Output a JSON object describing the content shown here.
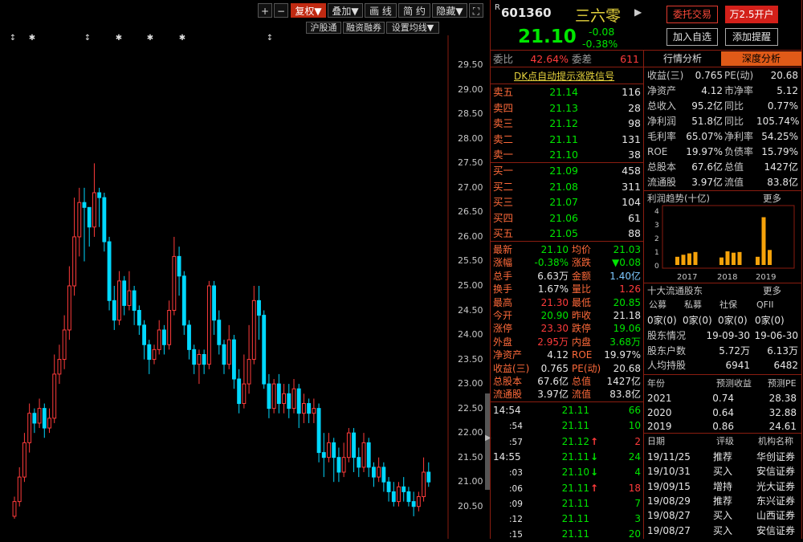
{
  "toolbar": {
    "zoom_in": "+",
    "zoom_out": "−",
    "fuquan": "复权▼",
    "diejia": "叠加▼",
    "huaxian": "画 线",
    "jianyue": "简 约",
    "yincang": "隐藏▼",
    "fullscreen": "⛶",
    "hugutong": "沪股通",
    "rongzi": "融资融券",
    "shezhi": "设置均线▼"
  },
  "chart_data": {
    "type": "candlestick",
    "y_ticks": [
      "29.50",
      "29.00",
      "28.50",
      "28.00",
      "27.50",
      "27.00",
      "26.50",
      "26.00",
      "25.50",
      "25.00",
      "24.50",
      "24.00",
      "23.50",
      "23.00",
      "22.50",
      "22.00",
      "21.50",
      "21.00",
      "20.50"
    ],
    "ylim": [
      20.25,
      29.75
    ],
    "candles": [
      [
        20.3,
        20.6,
        20.25,
        20.7
      ],
      [
        20.6,
        21.1,
        20.5,
        21.3
      ],
      [
        21.1,
        21.8,
        21.0,
        22.0
      ],
      [
        21.8,
        22.4,
        21.6,
        22.6
      ],
      [
        22.4,
        22.2,
        22.0,
        22.5
      ],
      [
        22.2,
        22.5,
        22.1,
        22.7
      ],
      [
        22.5,
        22.1,
        21.9,
        22.6
      ],
      [
        22.1,
        22.3,
        22.0,
        22.5
      ],
      [
        22.3,
        23.2,
        22.2,
        23.6
      ],
      [
        23.2,
        23.5,
        23.0,
        23.8
      ],
      [
        23.5,
        24.1,
        23.3,
        24.4
      ],
      [
        24.1,
        25.0,
        23.9,
        25.4
      ],
      [
        25.0,
        26.0,
        24.8,
        26.8
      ],
      [
        26.0,
        26.7,
        25.6,
        27.0
      ],
      [
        26.7,
        26.6,
        25.5,
        27.0
      ],
      [
        26.6,
        26.2,
        25.8,
        26.6
      ],
      [
        26.2,
        26.9,
        26.0,
        27.5
      ],
      [
        26.9,
        26.8,
        26.2,
        27.0
      ],
      [
        26.8,
        25.9,
        25.7,
        26.9
      ],
      [
        25.9,
        24.7,
        24.5,
        26.0
      ],
      [
        24.7,
        24.3,
        24.1,
        25.0
      ],
      [
        24.3,
        25.1,
        24.2,
        25.3
      ],
      [
        25.1,
        24.6,
        24.4,
        25.2
      ],
      [
        24.6,
        24.9,
        24.5,
        25.3
      ],
      [
        24.9,
        24.5,
        24.2,
        25.0
      ],
      [
        24.5,
        24.2,
        24.0,
        24.6
      ],
      [
        24.2,
        23.8,
        23.5,
        24.3
      ],
      [
        23.8,
        23.5,
        23.2,
        23.9
      ],
      [
        23.5,
        23.7,
        23.4,
        23.8
      ],
      [
        23.7,
        24.1,
        23.6,
        24.3
      ],
      [
        24.1,
        23.8,
        23.6,
        24.2
      ],
      [
        23.8,
        24.5,
        23.7,
        24.7
      ],
      [
        24.5,
        25.6,
        24.4,
        26.0
      ],
      [
        25.6,
        25.2,
        24.8,
        25.8
      ],
      [
        25.2,
        24.2,
        24.0,
        25.3
      ],
      [
        24.2,
        23.7,
        23.5,
        24.3
      ],
      [
        23.7,
        23.4,
        23.2,
        23.8
      ],
      [
        23.4,
        23.6,
        23.0,
        23.7
      ],
      [
        23.6,
        23.4,
        23.2,
        23.7
      ],
      [
        23.4,
        25.0,
        23.3,
        25.1
      ],
      [
        25.0,
        24.3,
        24.0,
        25.1
      ],
      [
        24.3,
        23.8,
        23.6,
        24.5
      ],
      [
        23.8,
        23.4,
        23.2,
        23.9
      ],
      [
        23.4,
        23.9,
        23.3,
        24.2
      ],
      [
        23.9,
        23.1,
        22.9,
        24.0
      ],
      [
        23.1,
        22.6,
        22.4,
        23.3
      ],
      [
        22.6,
        23.0,
        22.5,
        23.6
      ],
      [
        23.0,
        23.5,
        22.8,
        24.2
      ],
      [
        23.5,
        24.7,
        23.4,
        25.0
      ],
      [
        24.7,
        24.4,
        23.9,
        25.0
      ],
      [
        24.4,
        23.0,
        22.9,
        24.5
      ],
      [
        23.0,
        22.5,
        22.3,
        23.2
      ],
      [
        22.5,
        23.0,
        22.4,
        23.1
      ],
      [
        23.0,
        22.6,
        22.4,
        23.2
      ],
      [
        22.6,
        22.8,
        22.4,
        23.0
      ],
      [
        22.8,
        22.5,
        22.3,
        23.0
      ],
      [
        22.5,
        22.9,
        22.4,
        23.1
      ],
      [
        22.9,
        22.4,
        22.1,
        23.0
      ],
      [
        22.4,
        22.6,
        22.2,
        22.8
      ],
      [
        22.6,
        22.4,
        22.2,
        22.7
      ],
      [
        22.4,
        22.5,
        22.2,
        22.7
      ],
      [
        22.5,
        21.6,
        21.4,
        22.6
      ],
      [
        21.6,
        21.5,
        21.1,
        22.0
      ],
      [
        21.5,
        21.8,
        21.4,
        22.0
      ],
      [
        21.8,
        21.5,
        21.0,
        21.9
      ],
      [
        21.5,
        21.2,
        21.0,
        21.7
      ],
      [
        21.2,
        21.5,
        21.1,
        21.8
      ],
      [
        21.5,
        22.0,
        21.4,
        22.1
      ],
      [
        22.0,
        21.5,
        21.2,
        22.1
      ],
      [
        21.5,
        21.3,
        21.1,
        21.7
      ],
      [
        21.3,
        21.8,
        21.2,
        22.0
      ],
      [
        21.8,
        21.3,
        21.1,
        21.9
      ],
      [
        21.3,
        21.1,
        20.9,
        21.4
      ],
      [
        21.1,
        21.3,
        21.0,
        21.5
      ],
      [
        21.3,
        21.0,
        20.8,
        21.4
      ],
      [
        21.0,
        20.8,
        20.6,
        21.1
      ],
      [
        20.8,
        20.6,
        20.5,
        21.0
      ],
      [
        20.6,
        20.9,
        20.5,
        21.0
      ],
      [
        20.9,
        20.8,
        20.6,
        21.1
      ],
      [
        20.8,
        20.6,
        20.5,
        20.9
      ],
      [
        20.6,
        20.5,
        20.3,
        20.8
      ],
      [
        20.5,
        20.7,
        20.4,
        20.8
      ],
      [
        20.7,
        21.2,
        20.6,
        21.5
      ],
      [
        21.2,
        21.0,
        20.9,
        21.4
      ]
    ],
    "markers": [
      "↕",
      "✱",
      "↕",
      "✱",
      "✱",
      "✱",
      "↕",
      "↕"
    ]
  },
  "quote": {
    "prefix": "R",
    "code": "601360",
    "name": "三六零",
    "price": "21.10",
    "change": "-0.08",
    "change_pct": "-0.38%",
    "btn_weituo": "委托交易",
    "btn_kaihu": "万2.5开户",
    "btn_zixuan": "加入自选",
    "btn_tixing": "添加提醒"
  },
  "weibi": {
    "label1": "委比",
    "val1": "42.64%",
    "label2": "委差",
    "val2": "611"
  },
  "dk_signal": "DK点自动提示涨跌信号",
  "asks": [
    {
      "label": "卖五",
      "price": "21.14",
      "vol": "116"
    },
    {
      "label": "卖四",
      "price": "21.13",
      "vol": "28"
    },
    {
      "label": "卖三",
      "price": "21.12",
      "vol": "98"
    },
    {
      "label": "卖二",
      "price": "21.11",
      "vol": "131"
    },
    {
      "label": "卖一",
      "price": "21.10",
      "vol": "38"
    }
  ],
  "bids": [
    {
      "label": "买一",
      "price": "21.09",
      "vol": "458"
    },
    {
      "label": "买二",
      "price": "21.08",
      "vol": "311"
    },
    {
      "label": "买三",
      "price": "21.07",
      "vol": "104"
    },
    {
      "label": "买四",
      "price": "21.06",
      "vol": "61"
    },
    {
      "label": "买五",
      "price": "21.05",
      "vol": "88"
    }
  ],
  "stats": [
    {
      "l1": "最新",
      "v1": "21.10",
      "c1": "green",
      "l2": "均价",
      "v2": "21.03",
      "c2": "green"
    },
    {
      "l1": "涨幅",
      "v1": "-0.38%",
      "c1": "green",
      "l2": "涨跌",
      "v2": "▼0.08",
      "c2": "green"
    },
    {
      "l1": "总手",
      "v1": "6.63万",
      "c1": "white",
      "l2": "金额",
      "v2": "1.40亿",
      "c2": "cyan"
    },
    {
      "l1": "换手",
      "v1": "1.67%",
      "c1": "white",
      "l2": "量比",
      "v2": "1.26",
      "c2": "red"
    },
    {
      "l1": "最高",
      "v1": "21.30",
      "c1": "red",
      "l2": "最低",
      "v2": "20.85",
      "c2": "green"
    },
    {
      "l1": "今开",
      "v1": "20.90",
      "c1": "green",
      "l2": "昨收",
      "v2": "21.18",
      "c2": "white"
    },
    {
      "l1": "涨停",
      "v1": "23.30",
      "c1": "red",
      "l2": "跌停",
      "v2": "19.06",
      "c2": "green"
    },
    {
      "l1": "外盘",
      "v1": "2.95万",
      "c1": "red",
      "l2": "内盘",
      "v2": "3.68万",
      "c2": "green"
    },
    {
      "l1": "净资产",
      "v1": "4.12",
      "c1": "white",
      "l2": "ROE",
      "v2": "19.97%",
      "c2": "white"
    },
    {
      "l1": "收益(三)",
      "v1": "0.765",
      "c1": "white",
      "l2": "PE(动)",
      "v2": "20.68",
      "c2": "white"
    },
    {
      "l1": "总股本",
      "v1": "67.6亿",
      "c1": "white",
      "l2": "总值",
      "v2": "1427亿",
      "c2": "white"
    },
    {
      "l1": "流通股",
      "v1": "3.97亿",
      "c1": "white",
      "l2": "流值",
      "v2": "83.8亿",
      "c2": "white"
    }
  ],
  "ticks": [
    {
      "time": "14:54",
      "price": "21.11",
      "arrow": "",
      "vol": "66",
      "vc": "green"
    },
    {
      "time": ":54",
      "price": "21.11",
      "arrow": "",
      "vol": "10",
      "vc": "green"
    },
    {
      "time": ":57",
      "price": "21.12",
      "arrow": "↑",
      "vol": "2",
      "vc": "red"
    },
    {
      "time": "14:55",
      "price": "21.11",
      "arrow": "↓",
      "vol": "24",
      "vc": "green"
    },
    {
      "time": ":03",
      "price": "21.10",
      "arrow": "↓",
      "vol": "4",
      "vc": "green"
    },
    {
      "time": ":06",
      "price": "21.11",
      "arrow": "↑",
      "vol": "18",
      "vc": "red"
    },
    {
      "time": ":09",
      "price": "21.11",
      "arrow": "",
      "vol": "7",
      "vc": "green"
    },
    {
      "time": ":12",
      "price": "21.11",
      "arrow": "",
      "vol": "3",
      "vc": "green"
    },
    {
      "time": ":15",
      "price": "21.11",
      "arrow": "",
      "vol": "20",
      "vc": "green"
    }
  ],
  "tabs": {
    "hangqing": "行情分析",
    "shendu": "深度分析"
  },
  "fundamentals": [
    {
      "l1": "收益(三)",
      "v1": "0.765",
      "l2": "PE(动)",
      "v2": "20.68"
    },
    {
      "l1": "净资产",
      "v1": "4.12",
      "l2": "市净率",
      "v2": "5.12"
    },
    {
      "l1": "总收入",
      "v1": "95.2亿",
      "l2": "同比",
      "v2": "0.77%"
    },
    {
      "l1": "净利润",
      "v1": "51.8亿",
      "l2": "同比",
      "v2": "105.74%"
    },
    {
      "l1": "毛利率",
      "v1": "65.07%",
      "l2": "净利率",
      "v2": "54.25%"
    },
    {
      "l1": "ROE",
      "v1": "19.97%",
      "l2": "负债率",
      "v2": "15.79%"
    },
    {
      "l1": "总股本",
      "v1": "67.6亿",
      "l2": "总值",
      "v2": "1427亿"
    },
    {
      "l1": "流通股",
      "v1": "3.97亿",
      "l2": "流值",
      "v2": "83.8亿"
    }
  ],
  "profit_trend": {
    "title": "利润趋势(十亿)",
    "more": "更多",
    "y_ticks": [
      "4",
      "3",
      "2",
      "1",
      "0"
    ],
    "years": [
      "2017",
      "2018",
      "2019"
    ],
    "bars": [
      0.6,
      0.75,
      0.85,
      0.95,
      0.55,
      1.0,
      0.9,
      0.95,
      0.6,
      3.5,
      1.1
    ],
    "ylim": [
      0,
      4
    ]
  },
  "holders": {
    "title": "十大流通股东",
    "more": "更多",
    "headers": [
      "公募",
      "私募",
      "社保",
      "QFII"
    ],
    "values": [
      "0家(0)",
      "0家(0)",
      "0家(0)",
      "0家(0)"
    ]
  },
  "holder_stats": [
    {
      "l": "股东情况",
      "v1": "19-09-30",
      "v2": "19-06-30"
    },
    {
      "l": "股东户数",
      "v1": "5.72万",
      "v2": "6.13万"
    },
    {
      "l": "人均持股",
      "v1": "6941",
      "v2": "6482"
    }
  ],
  "forecast": {
    "headers": [
      "年份",
      "预测收益",
      "预测PE"
    ],
    "rows": [
      [
        "2021",
        "0.74",
        "28.38"
      ],
      [
        "2020",
        "0.64",
        "32.88"
      ],
      [
        "2019",
        "0.86",
        "24.61"
      ]
    ]
  },
  "ratings": {
    "headers": [
      "日期",
      "评级",
      "机构名称"
    ],
    "rows": [
      [
        "19/11/25",
        "推荐",
        "华创证券"
      ],
      [
        "19/10/31",
        "买入",
        "安信证券"
      ],
      [
        "19/09/15",
        "增持",
        "光大证券"
      ],
      [
        "19/08/29",
        "推荐",
        "东兴证券"
      ],
      [
        "19/08/27",
        "买入",
        "山西证券"
      ],
      [
        "19/08/27",
        "买入",
        "安信证券"
      ]
    ]
  }
}
